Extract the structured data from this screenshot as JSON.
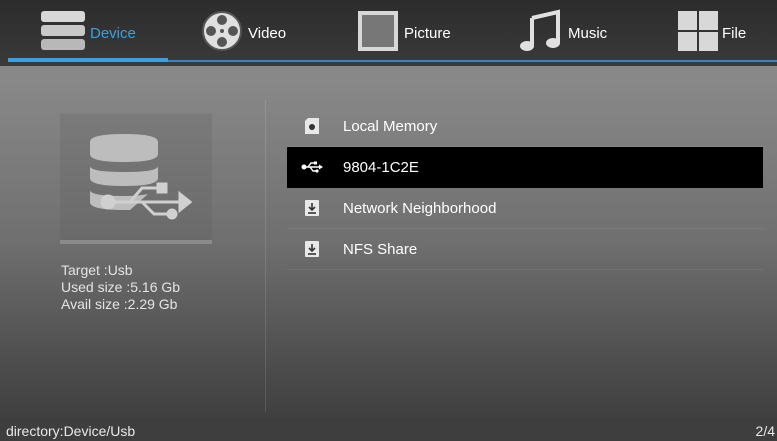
{
  "tabs": [
    {
      "label": "Device",
      "icon": "database-icon",
      "active": true
    },
    {
      "label": "Video",
      "icon": "film-reel-icon",
      "active": false
    },
    {
      "label": "Picture",
      "icon": "picture-frame-icon",
      "active": false
    },
    {
      "label": "Music",
      "icon": "music-note-icon",
      "active": false
    },
    {
      "label": "File",
      "icon": "grid-icon",
      "active": false
    }
  ],
  "device": {
    "image_icon": "usb-database-icon",
    "target": "Target :Usb",
    "used_size": "Used size :5.16 Gb",
    "avail_size": "Avail size :2.29 Gb"
  },
  "list": [
    {
      "label": "Local Memory",
      "icon": "sd-card-icon",
      "selected": false
    },
    {
      "label": "9804-1C2E",
      "icon": "usb-icon",
      "selected": true
    },
    {
      "label": "Network Neighborhood",
      "icon": "network-share-icon",
      "selected": false
    },
    {
      "label": "NFS Share",
      "icon": "nfs-share-icon",
      "selected": false
    }
  ],
  "status": {
    "directory": "directory:Device/Usb",
    "page": "2/4"
  },
  "colors": {
    "accent": "#3aa0e0",
    "selected_row": "#000000"
  }
}
